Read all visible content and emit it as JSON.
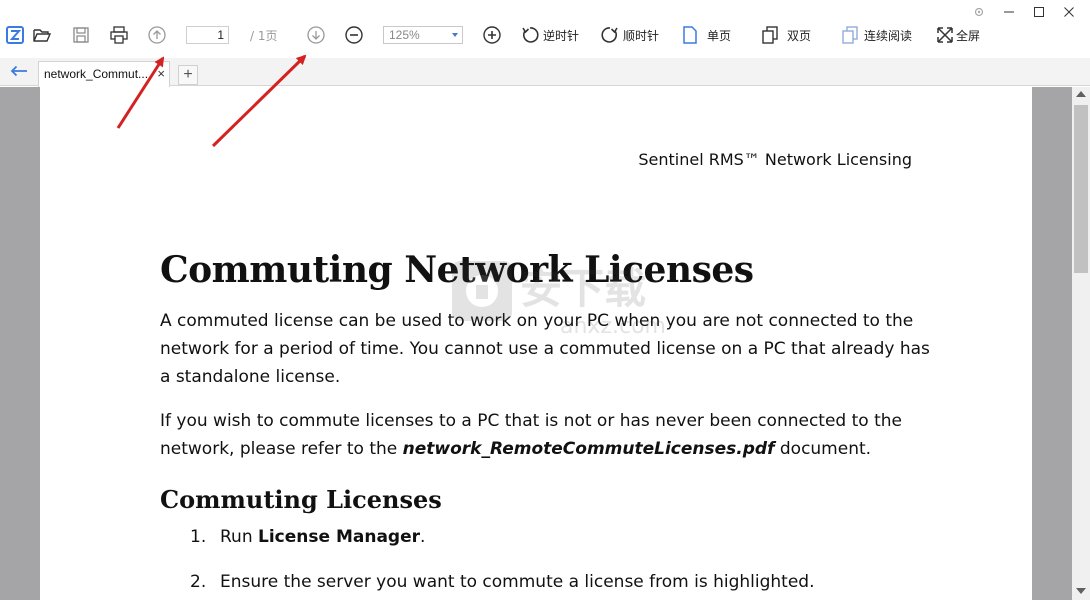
{
  "toolbar": {
    "page_current": "1",
    "page_total": "/ 1页",
    "zoom": "125%",
    "rotate_ccw_label": "逆时针",
    "rotate_cw_label": "顺时针",
    "single_page_label": "单页",
    "double_page_label": "双页",
    "continuous_label": "连续阅读",
    "fullscreen_label": "全屏"
  },
  "tabs": [
    {
      "label": "network_Commut...",
      "close": "×"
    }
  ],
  "tab_add": "+",
  "document": {
    "header": "Sentinel RMS™ Network Licensing",
    "title": "Commuting Network Licenses",
    "para1": "A commuted license can be used to work on your PC when you are not connected to the network for a period of time. You cannot use a commuted license on a PC that already has a standalone license.",
    "para2_pre": "If you wish to commute licenses to a PC that is not or has never been connected to the network, please refer to the ",
    "para2_link": "network_RemoteCommuteLicenses.pdf",
    "para2_post": " document.",
    "section": "Commuting Licenses",
    "steps": [
      {
        "num": "1.",
        "pre": "Run ",
        "bold": "License Manager",
        "post": "."
      },
      {
        "num": "2.",
        "pre": "Ensure the server you want to commute a license from is highlighted.",
        "bold": "",
        "post": ""
      }
    ]
  },
  "watermark": {
    "text": "安下载",
    "subtext": "anxz.com"
  },
  "icons": {
    "app": "app-logo-icon",
    "open": "folder-open-icon",
    "save": "save-icon",
    "print": "print-icon",
    "prev": "arrow-up-circle-icon",
    "next": "arrow-down-circle-icon",
    "zoom_out": "minus-circle-icon",
    "zoom_in": "plus-circle-icon"
  },
  "colors": {
    "accent": "#4a78c8",
    "annotation_arrow": "#d42222",
    "doc_background": "#a5a4a6"
  }
}
